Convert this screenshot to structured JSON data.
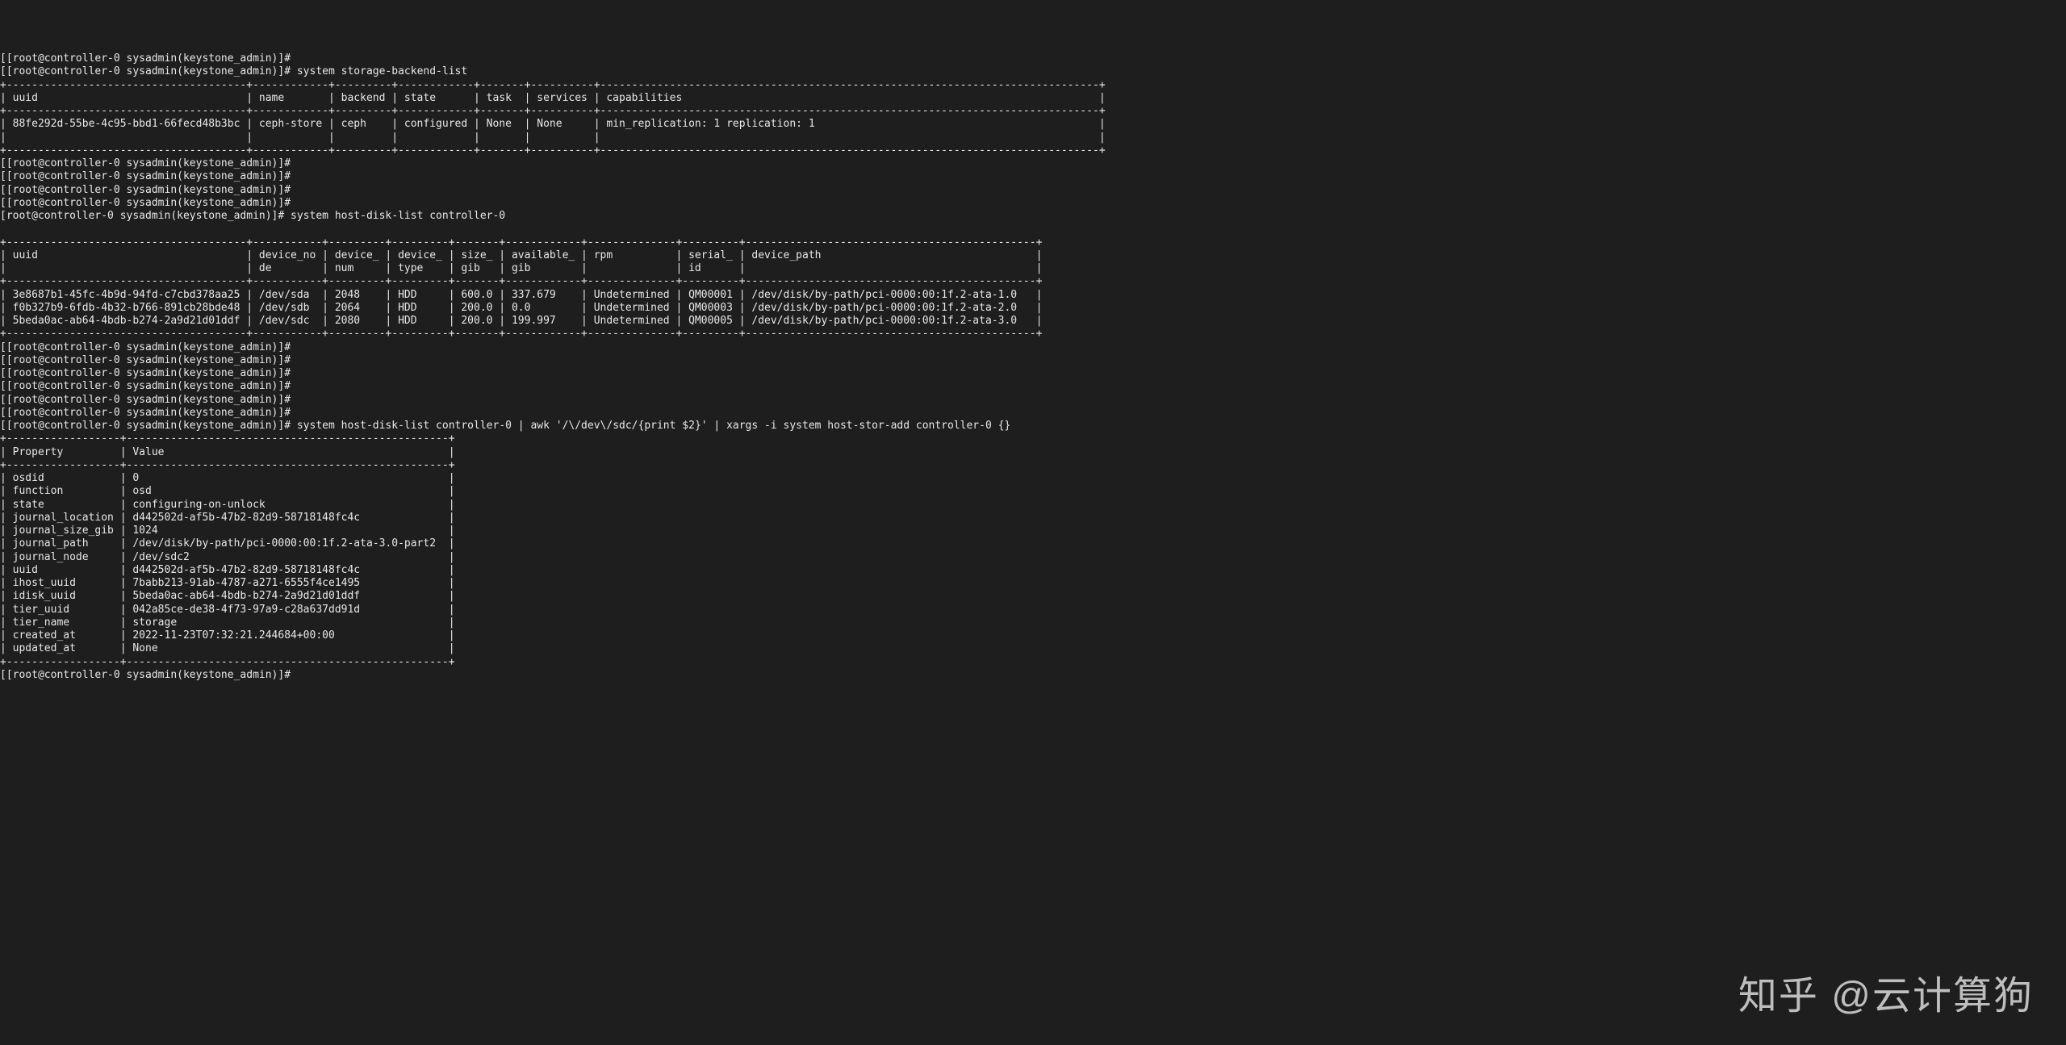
{
  "prompt": "[root@controller-0 sysadmin(keystone_admin)]#",
  "prompt_prefixed": "[[root@controller-0 sysadmin(keystone_admin)]#",
  "cmd1": "system storage-backend-list",
  "cmd2": "system host-disk-list controller-0",
  "cmd3": "system host-disk-list controller-0 | awk '/\\/dev\\/sdc/{print $2}' | xargs -i system host-stor-add controller-0 {}",
  "table1": {
    "headers": [
      "uuid",
      "name",
      "backend",
      "state",
      "task",
      "services",
      "capabilities"
    ],
    "rows": [
      {
        "uuid": "88fe292d-55be-4c95-bbd1-66fecd48b3bc",
        "name": "ceph-store",
        "backend": "ceph",
        "state": "configured",
        "task": "None",
        "services": "None",
        "capabilities": "min_replication: 1 replication: 1"
      }
    ]
  },
  "table2": {
    "headers": [
      "uuid",
      "device_no\nde",
      "device_\nnum",
      "device_\ntype",
      "size_\ngib",
      "available_\ngib",
      "rpm",
      "serial_\nid",
      "device_path"
    ],
    "rows": [
      {
        "uuid": "3e8687b1-45fc-4b9d-94fd-c7cbd378aa25",
        "device_node": "/dev/sda",
        "device_num": "2048",
        "device_type": "HDD",
        "size_gib": "600.0",
        "available_gib": "337.679",
        "rpm": "Undetermined",
        "serial_id": "QM00001",
        "device_path": "/dev/disk/by-path/pci-0000:00:1f.2-ata-1.0"
      },
      {
        "uuid": "f0b327b9-6fdb-4b32-b766-891cb28bde48",
        "device_node": "/dev/sdb",
        "device_num": "2064",
        "device_type": "HDD",
        "size_gib": "200.0",
        "available_gib": "0.0",
        "rpm": "Undetermined",
        "serial_id": "QM00003",
        "device_path": "/dev/disk/by-path/pci-0000:00:1f.2-ata-2.0"
      },
      {
        "uuid": "5beda0ac-ab64-4bdb-b274-2a9d21d01ddf",
        "device_node": "/dev/sdc",
        "device_num": "2080",
        "device_type": "HDD",
        "size_gib": "200.0",
        "available_gib": "199.997",
        "rpm": "Undetermined",
        "serial_id": "QM00005",
        "device_path": "/dev/disk/by-path/pci-0000:00:1f.2-ata-3.0"
      }
    ]
  },
  "table3": {
    "headers": [
      "Property",
      "Value"
    ],
    "rows": [
      {
        "k": "osdid",
        "v": "0"
      },
      {
        "k": "function",
        "v": "osd"
      },
      {
        "k": "state",
        "v": "configuring-on-unlock"
      },
      {
        "k": "journal_location",
        "v": "d442502d-af5b-47b2-82d9-58718148fc4c"
      },
      {
        "k": "journal_size_gib",
        "v": "1024"
      },
      {
        "k": "journal_path",
        "v": "/dev/disk/by-path/pci-0000:00:1f.2-ata-3.0-part2"
      },
      {
        "k": "journal_node",
        "v": "/dev/sdc2"
      },
      {
        "k": "uuid",
        "v": "d442502d-af5b-47b2-82d9-58718148fc4c"
      },
      {
        "k": "ihost_uuid",
        "v": "7babb213-91ab-4787-a271-6555f4ce1495"
      },
      {
        "k": "idisk_uuid",
        "v": "5beda0ac-ab64-4bdb-b274-2a9d21d01ddf"
      },
      {
        "k": "tier_uuid",
        "v": "042a85ce-de38-4f73-97a9-c28a637dd91d"
      },
      {
        "k": "tier_name",
        "v": "storage"
      },
      {
        "k": "created_at",
        "v": "2022-11-23T07:32:21.244684+00:00"
      },
      {
        "k": "updated_at",
        "v": "None"
      }
    ]
  },
  "watermark": "知乎 @云计算狗"
}
